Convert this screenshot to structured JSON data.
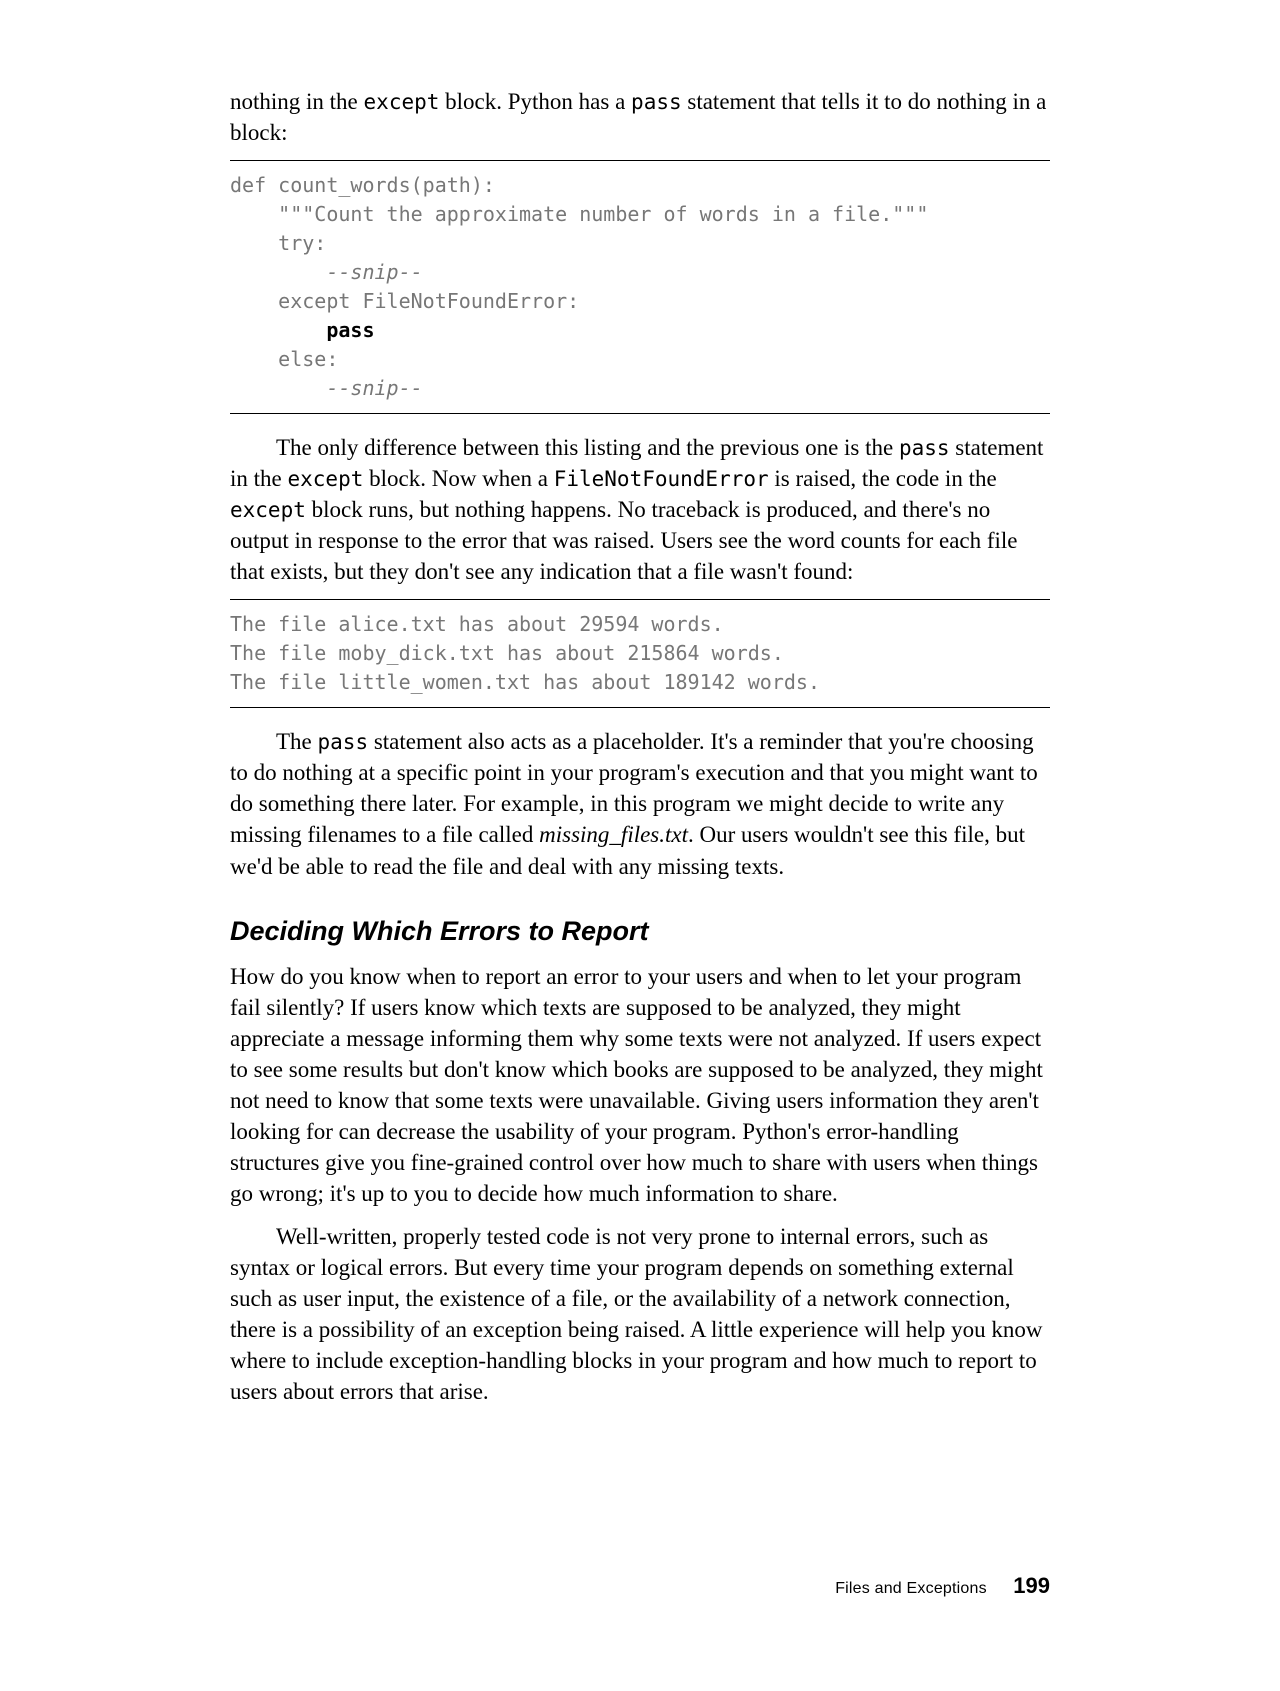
{
  "para1_a": "nothing in the ",
  "para1_b": "except",
  "para1_c": " block. Python has a ",
  "para1_d": "pass",
  "para1_e": " statement that tells it to do nothing in a block:",
  "code1": {
    "l1": "def count_words(path):",
    "l2": "    \"\"\"Count the approximate number of words in a file.\"\"\"",
    "l3": "    try:",
    "l4": "        --snip--",
    "l5": "    except FileNotFoundError:",
    "l6_pad": "        ",
    "l6_strong": "pass",
    "l7": "    else:",
    "l8": "        --snip--"
  },
  "para2_a": "The only difference between this listing and the previous one is the ",
  "para2_b": "pass",
  "para2_c": " statement in the ",
  "para2_d": "except",
  "para2_e": " block. Now when a ",
  "para2_f": "FileNotFoundError",
  "para2_g": " is raised, the code in the ",
  "para2_h": "except",
  "para2_i": " block runs, but nothing happens. No traceback is produced, and there's no output in response to the error that was raised. Users see the word counts for each file that exists, but they don't see any indication that a file wasn't found:",
  "code2": {
    "l1": "The file alice.txt has about 29594 words.",
    "l2": "The file moby_dick.txt has about 215864 words.",
    "l3": "The file little_women.txt has about 189142 words."
  },
  "para3_a": "The ",
  "para3_b": "pass",
  "para3_c": " statement also acts as a placeholder. It's a reminder that you're choosing to do nothing at a specific point in your program's execution and that you might want to do something there later. For example, in this program we might decide to write any missing filenames to a file called ",
  "para3_d": "missing_files.txt",
  "para3_e": ". Our users wouldn't see this file, but we'd be able to read the file and deal with any missing texts.",
  "heading1": "Deciding Which Errors to Report",
  "para4": "How do you know when to report an error to your users and when to let your program fail silently? If users know which texts are supposed to be analyzed, they might appreciate a message informing them why some texts were not analyzed. If users expect to see some results but don't know which books are supposed to be analyzed, they might not need to know that some texts were unavailable. Giving users information they aren't looking for can decrease the usability of your program. Python's error-handling structures give you fine-grained control over how much to share with users when things go wrong; it's up to you to decide how much information to share.",
  "para5": "Well-written, properly tested code is not very prone to internal errors, such as syntax or logical errors. But every time your program depends on something external such as user input, the existence of a file, or the availability of a network connection, there is a possibility of an exception being raised. A little experience will help you know where to include exception-handling blocks in your program and how much to report to users about errors that arise.",
  "footer_title": "Files and Exceptions",
  "footer_page": "199"
}
